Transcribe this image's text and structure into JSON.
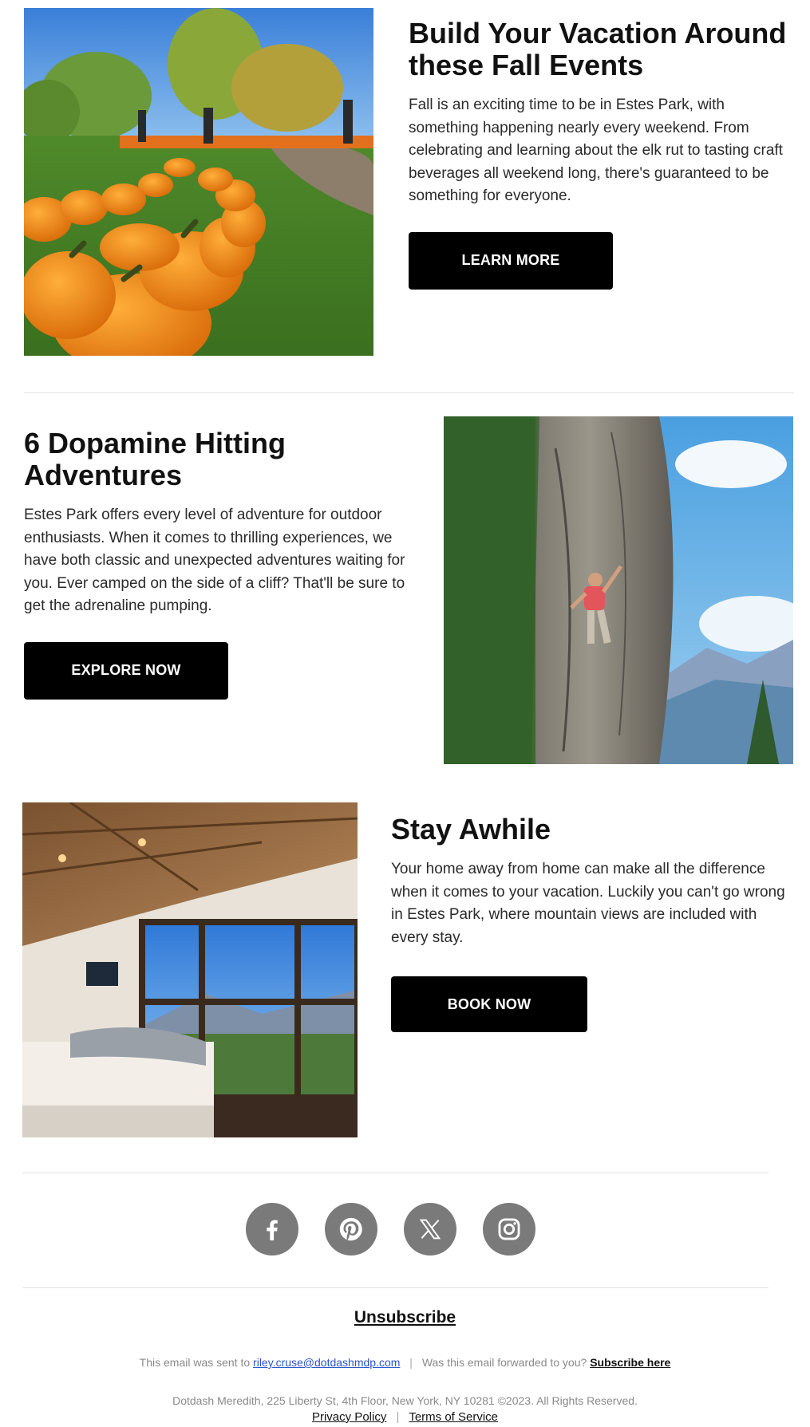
{
  "sections": [
    {
      "title": "Build Your Vacation Around these Fall Events",
      "body": "Fall is an exciting time to be in Estes Park, with something happening nearly every weekend. From celebrating and learning about the elk rut to tasting craft beverages all weekend long, there's guaranteed to be something for everyone.",
      "cta": "LEARN MORE",
      "image": "pumpkin-patch-photo"
    },
    {
      "title": "6 Dopamine Hitting Adventures",
      "body": "Estes Park offers every level of adventure for outdoor enthusiasts. When it comes to thrilling experiences, we have both classic and unexpected adventures waiting for you. Ever camped on the side of a cliff? That'll be sure to get the adrenaline pumping.",
      "cta": "EXPLORE NOW",
      "image": "rock-climber-photo"
    },
    {
      "title": "Stay Awhile",
      "body": "Your home away from home can make all the difference when it comes to your vacation. Luckily you can't go wrong in Estes Park, where mountain views are included with every stay.",
      "cta": "BOOK NOW",
      "image": "cabin-bedroom-photo"
    }
  ],
  "social": [
    {
      "icon": "facebook-icon"
    },
    {
      "icon": "pinterest-icon"
    },
    {
      "icon": "x-icon"
    },
    {
      "icon": "instagram-icon"
    }
  ],
  "footer": {
    "unsubscribe": "Unsubscribe",
    "sent_to_prefix": "This email was sent to",
    "email": "riley.cruse@dotdashmdp.com",
    "forwarded": "Was this email forwarded to you?",
    "subscribe": "Subscribe here",
    "address": "Dotdash Meredith, 225 Liberty St, 4th Floor, New York, NY 10281 ©2023. All Rights Reserved.",
    "privacy": "Privacy Policy",
    "terms": "Terms of Service"
  },
  "colors": {
    "button_bg": "#000000",
    "social_bg": "#7a7a7a",
    "link_blue": "#2a55c8"
  }
}
